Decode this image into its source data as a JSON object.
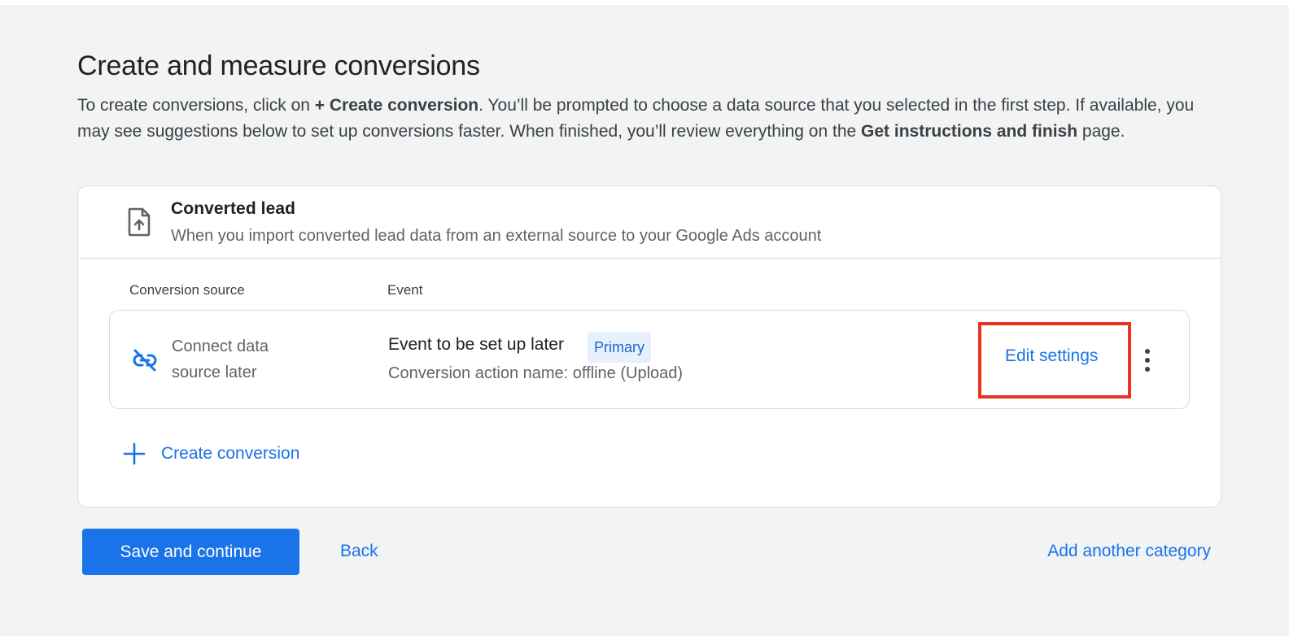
{
  "page": {
    "title": "Create and measure conversions",
    "intro": {
      "p1": "To create conversions, click on ",
      "b1": "+ Create conversion",
      "p2": ". You’ll be prompted to choose a data source that you selected in the first step. If available, you may see suggestions below to set up conversions faster. When finished, you’ll review everything on the ",
      "b2": "Get instructions and finish",
      "p3": " page."
    }
  },
  "card": {
    "icon": "file-upload-icon",
    "title": "Converted lead",
    "subtitle": "When you import converted lead data from an external source to your Google Ads account",
    "columns": {
      "source": "Conversion source",
      "event": "Event"
    },
    "row": {
      "source_icon": "link-off-icon",
      "source_label": "Connect data source later",
      "event_title": "Event to be set up later",
      "badge": "Primary",
      "action_name": "Conversion action name: offline (Upload)",
      "edit_label": "Edit settings",
      "more_icon": "more-vert-icon"
    },
    "create_label": "Create conversion"
  },
  "footer": {
    "save_label": "Save and continue",
    "back_label": "Back",
    "add_category_label": "Add another category"
  },
  "colors": {
    "accent": "#1a73e8",
    "highlight": "#ea3323",
    "chip_bg": "#e8f0fe",
    "background": "#f1f3f4"
  }
}
